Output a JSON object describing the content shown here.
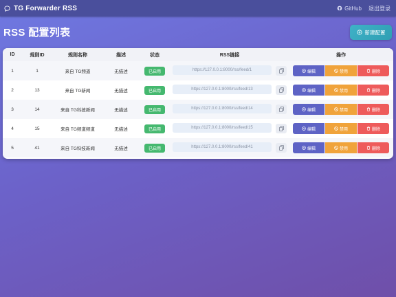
{
  "app": {
    "title": "TG Forwarder RSS"
  },
  "topbar": {
    "github_label": "GitHub",
    "logout_label": "退出登录"
  },
  "page": {
    "title": "RSS 配置列表",
    "new_button": "新建配置"
  },
  "table": {
    "headers": [
      "ID",
      "规则ID",
      "规则名称",
      "描述",
      "状态",
      "RSS链接",
      "操作"
    ],
    "rows": [
      {
        "id": "1",
        "rule_id": "1",
        "name": "来自 TG频道",
        "desc": "无描述",
        "status": "已启用",
        "link": "https://127.0.0.1:8000/rss/feed/1"
      },
      {
        "id": "2",
        "rule_id": "13",
        "name": "来自 TG新闻",
        "desc": "无描述",
        "status": "已启用",
        "link": "https://127.0.0.1:8000/rss/feed/13"
      },
      {
        "id": "3",
        "rule_id": "14",
        "name": "来自 TG科技新闻",
        "desc": "无描述",
        "status": "已启用",
        "link": "https://127.0.0.1:8000/rss/feed/14"
      },
      {
        "id": "4",
        "rule_id": "15",
        "name": "来自 TG频道频道",
        "desc": "无描述",
        "status": "已启用",
        "link": "https://127.0.0.1:8000/rss/feed/15"
      },
      {
        "id": "5",
        "rule_id": "41",
        "name": "来自 TG科技新闻",
        "desc": "无描述",
        "status": "已启用",
        "link": "https://127.0.0.1:8000/rss/feed/41"
      }
    ],
    "actions": {
      "edit": "编辑",
      "toggle": "禁用",
      "delete": "删除"
    }
  },
  "colors": {
    "topbar": "#4a4f9c",
    "accent": "#3fb1c7",
    "status_enabled": "#45b86f",
    "edit": "#5e63c5",
    "toggle": "#f0a33b",
    "delete": "#ee5b5b"
  },
  "icons": {
    "brand": "chat-bubble-icon",
    "github": "github-icon",
    "new": "plus-circle-icon",
    "copy": "copy-icon",
    "edit": "edit-icon",
    "toggle": "ban-icon",
    "delete": "trash-icon"
  }
}
